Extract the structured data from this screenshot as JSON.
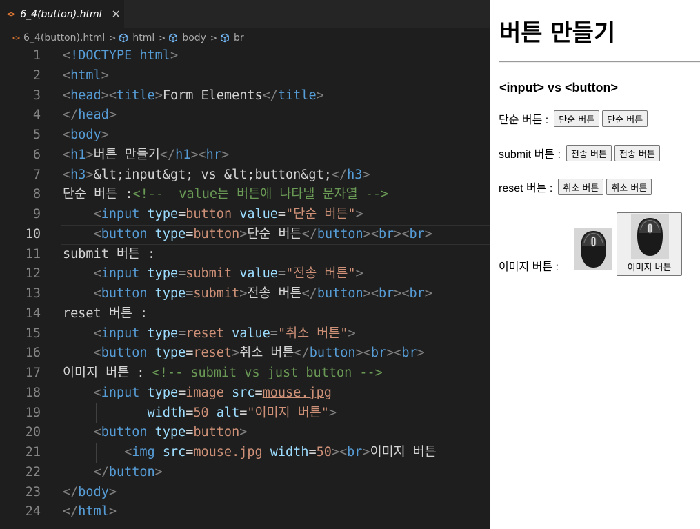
{
  "editor": {
    "tab": {
      "icon": "<>",
      "filename": "6_4(button).html",
      "close": "✕"
    },
    "breadcrumb": [
      "6_4(button).html",
      "html",
      "body",
      "br"
    ],
    "active_line": 10
  },
  "code_lines": [
    "<!DOCTYPE html>",
    "<html>",
    "<head><title>Form Elements</title>",
    "</head>",
    "<body>",
    "<h1>버튼 만들기</h1><hr>",
    "<h3>&lt;input&gt; vs &lt;button&gt;</h3>",
    "단순 버튼 :<!--  value는 버튼에 나타낼 문자열 -->",
    "    <input type=button value=\"단순 버튼\">",
    "    <button type=button>단순 버튼</button><br><br>",
    "submit 버튼 :",
    "    <input type=submit value=\"전송 버튼\">",
    "    <button type=submit>전송 버튼</button><br><br>",
    "reset 버튼 :",
    "    <input type=reset value=\"취소 버튼\">",
    "    <button type=reset>취소 버튼</button><br><br>",
    "이미지 버튼 : <!-- submit vs just button -->",
    "    <input type=image src=mouse.jpg",
    "           width=50 alt=\"이미지 버튼\">",
    "    <button type=button>",
    "        <img src=mouse.jpg width=50><br>이미지 버튼",
    "    </button>",
    "</body>",
    "</html>"
  ],
  "preview": {
    "h1": "버튼 만들기",
    "h3": "<input> vs <button>",
    "rows": [
      {
        "label": "단순 버튼 :",
        "buttons": [
          "단순 버튼",
          "단순 버튼"
        ]
      },
      {
        "label": "submit 버튼 :",
        "buttons": [
          "전송 버튼",
          "전송 버튼"
        ]
      },
      {
        "label": "reset 버튼 :",
        "buttons": [
          "취소 버튼",
          "취소 버튼"
        ]
      }
    ],
    "image_row": {
      "label": "이미지 버튼 :",
      "button_label": "이미지 버튼",
      "image_icon": "mouse-icon"
    }
  },
  "colors": {
    "editor_bg": "#1e1e1e",
    "tag": "#569cd6",
    "attr": "#9cdcfe",
    "string": "#ce9178",
    "comment": "#6a9955"
  }
}
